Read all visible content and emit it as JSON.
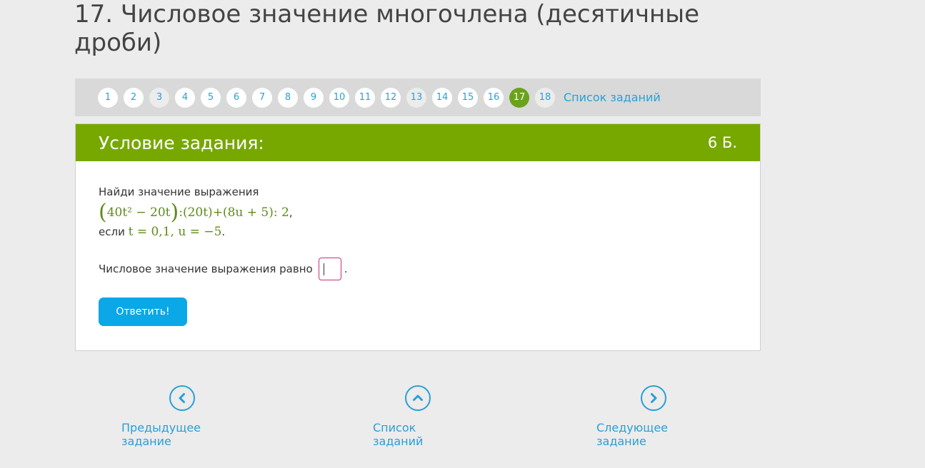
{
  "page": {
    "title": "17. Числовое значение многочлена (десятичные дроби)"
  },
  "task_nav": {
    "items": [
      {
        "label": "1",
        "state": "open"
      },
      {
        "label": "2",
        "state": "open"
      },
      {
        "label": "3",
        "state": "done"
      },
      {
        "label": "4",
        "state": "open"
      },
      {
        "label": "5",
        "state": "open"
      },
      {
        "label": "6",
        "state": "open"
      },
      {
        "label": "7",
        "state": "open"
      },
      {
        "label": "8",
        "state": "open"
      },
      {
        "label": "9",
        "state": "open"
      },
      {
        "label": "10",
        "state": "open"
      },
      {
        "label": "11",
        "state": "open"
      },
      {
        "label": "12",
        "state": "open"
      },
      {
        "label": "13",
        "state": "done"
      },
      {
        "label": "14",
        "state": "open"
      },
      {
        "label": "15",
        "state": "open"
      },
      {
        "label": "16",
        "state": "open"
      },
      {
        "label": "17",
        "state": "current"
      },
      {
        "label": "18",
        "state": "done"
      }
    ],
    "list_link": "Список заданий"
  },
  "card": {
    "header_title": "Условие задания:",
    "points": "6 Б.",
    "prompt": "Найди значение выражения",
    "expression": {
      "open_paren": "(",
      "inner": "40t² − 20t",
      "close_paren": ")",
      "rest": ":(20t)+(8u + 5): 2",
      "trailing": ","
    },
    "condition_prefix": "если ",
    "condition_math": "t = 0,1,  u = −5",
    "condition_suffix": ".",
    "answer_label": "Числовое значение выражения равно",
    "answer_value": "",
    "answer_suffix": ".",
    "submit_label": "Ответить!"
  },
  "bottom_nav": {
    "prev_label": "Предыдущее задание",
    "list_label": "Список заданий",
    "next_label": "Следующее задание"
  },
  "colors": {
    "accent_green": "#76a800",
    "link_blue": "#2a9fd6",
    "button_blue": "#0aa8e6",
    "input_border": "#c5307a"
  }
}
